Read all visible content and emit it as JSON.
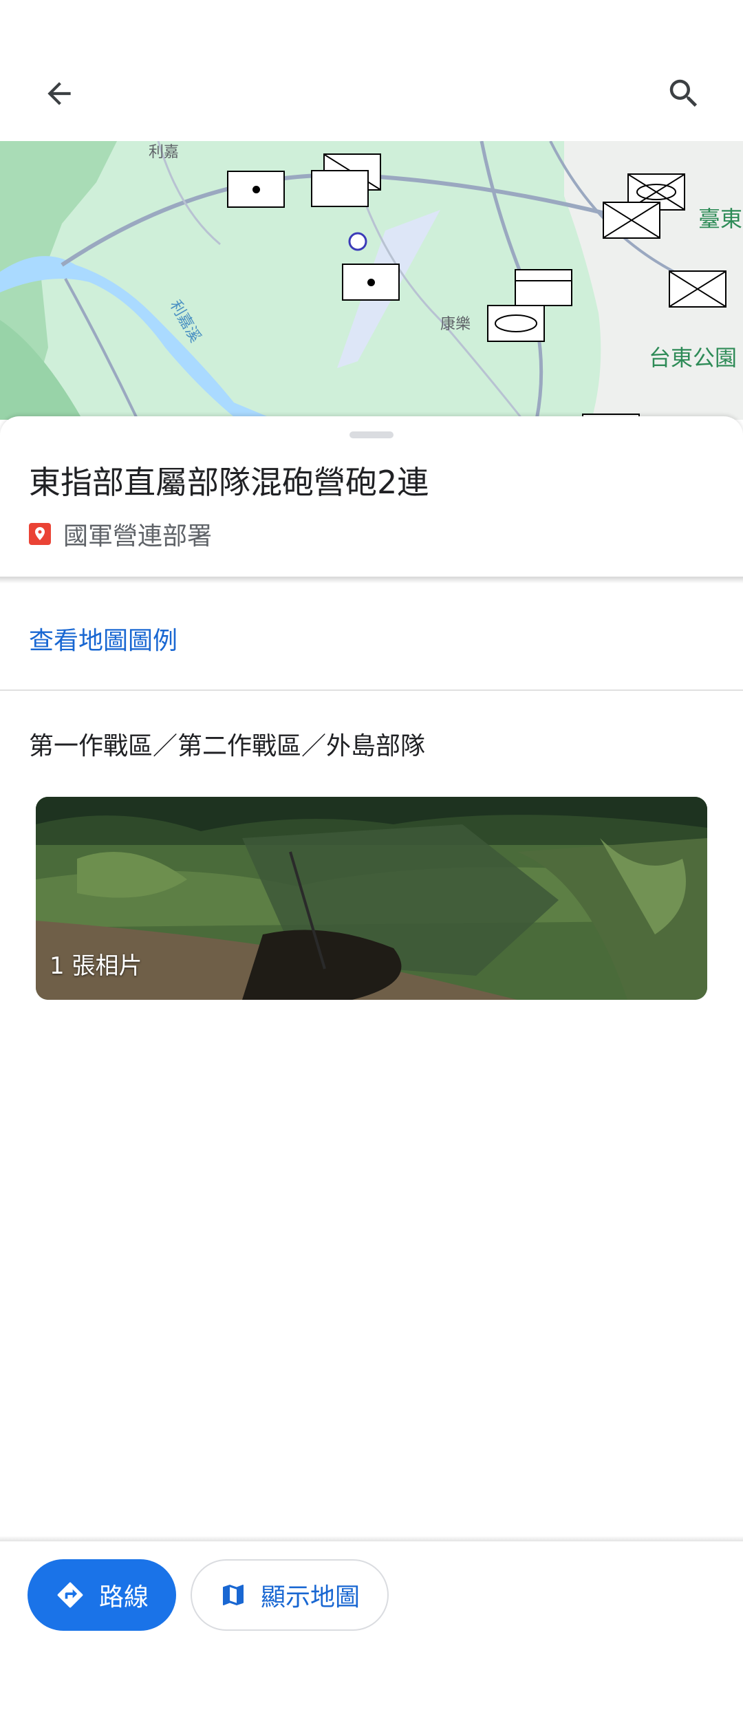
{
  "map": {
    "labels": {
      "lijia": "利嘉",
      "lijia_river": "利嘉溪",
      "kangle": "康樂",
      "taitung_city": "臺東",
      "taitung_park": "台東公園"
    }
  },
  "place": {
    "title": "東指部直屬部隊混砲營砲2連",
    "category": "國軍營連部署"
  },
  "legend_link": "查看地圖圖例",
  "description": "第一作戰區／第二作戰區／外島部隊",
  "photo": {
    "count_label": "1 張相片"
  },
  "actions": {
    "directions_label": "路線",
    "show_map_label": "顯示地圖"
  },
  "colors": {
    "accent": "#1a73e8",
    "link": "#1967d2",
    "pin": "#ea4335",
    "map_land": "#cfefd9",
    "map_water": "#aadaff"
  },
  "icons": {
    "back": "arrow-back-icon",
    "search": "search-icon",
    "pin": "place-pin-icon",
    "directions": "directions-icon",
    "map": "map-icon"
  }
}
